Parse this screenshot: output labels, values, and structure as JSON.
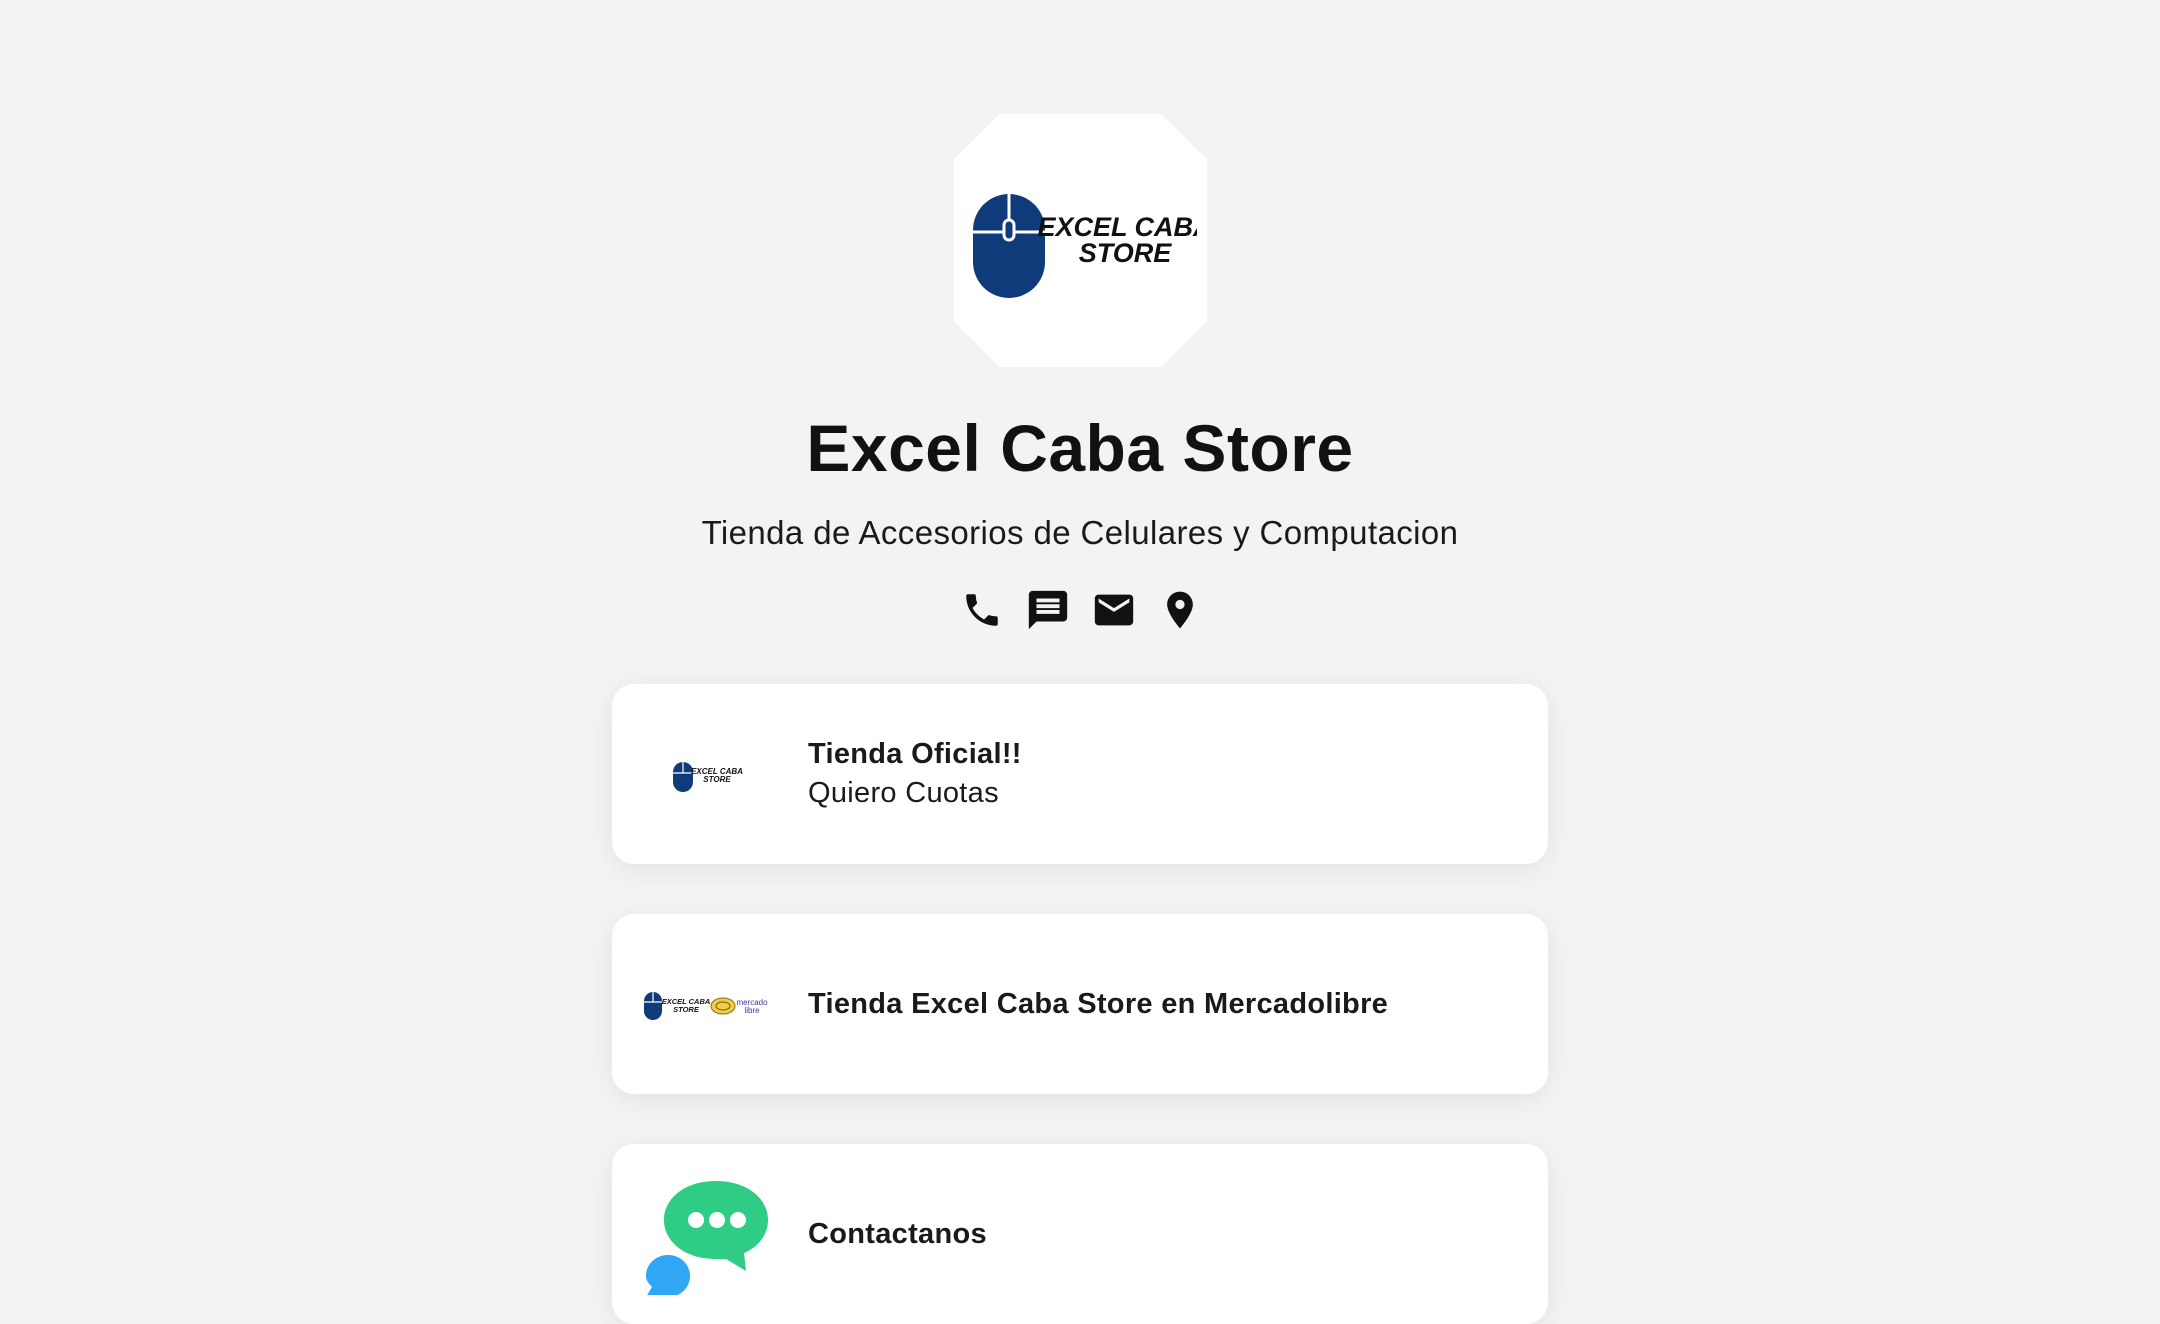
{
  "profile": {
    "logo_text_line1": "EXCEL CABA",
    "logo_text_line2": "STORE",
    "name": "Excel Caba Store",
    "description": "Tienda de Accesorios de Celulares y Computacion"
  },
  "socials": [
    {
      "icon": "phone-icon"
    },
    {
      "icon": "sms-icon"
    },
    {
      "icon": "email-icon"
    },
    {
      "icon": "location-pin-icon"
    }
  ],
  "links": [
    {
      "title": "Tienda Oficial!!",
      "subtitle": "Quiero Cuotas",
      "thumb": "excel-caba-store-logo"
    },
    {
      "title": "Tienda Excel Caba Store en Mercadolibre",
      "thumb": "excel-caba-mercadolibre-logo",
      "thumb_text": [
        "EXCEL CABA",
        "STORE",
        "mercado",
        "libre"
      ]
    },
    {
      "title": "Contactanos",
      "thumb": "chat-bubbles-icon"
    }
  ],
  "colors": {
    "background": "#f3f3f3",
    "brand_blue": "#0f3b7a",
    "chat_green": "#2ecc85",
    "chat_blue": "#2fa7f5"
  }
}
